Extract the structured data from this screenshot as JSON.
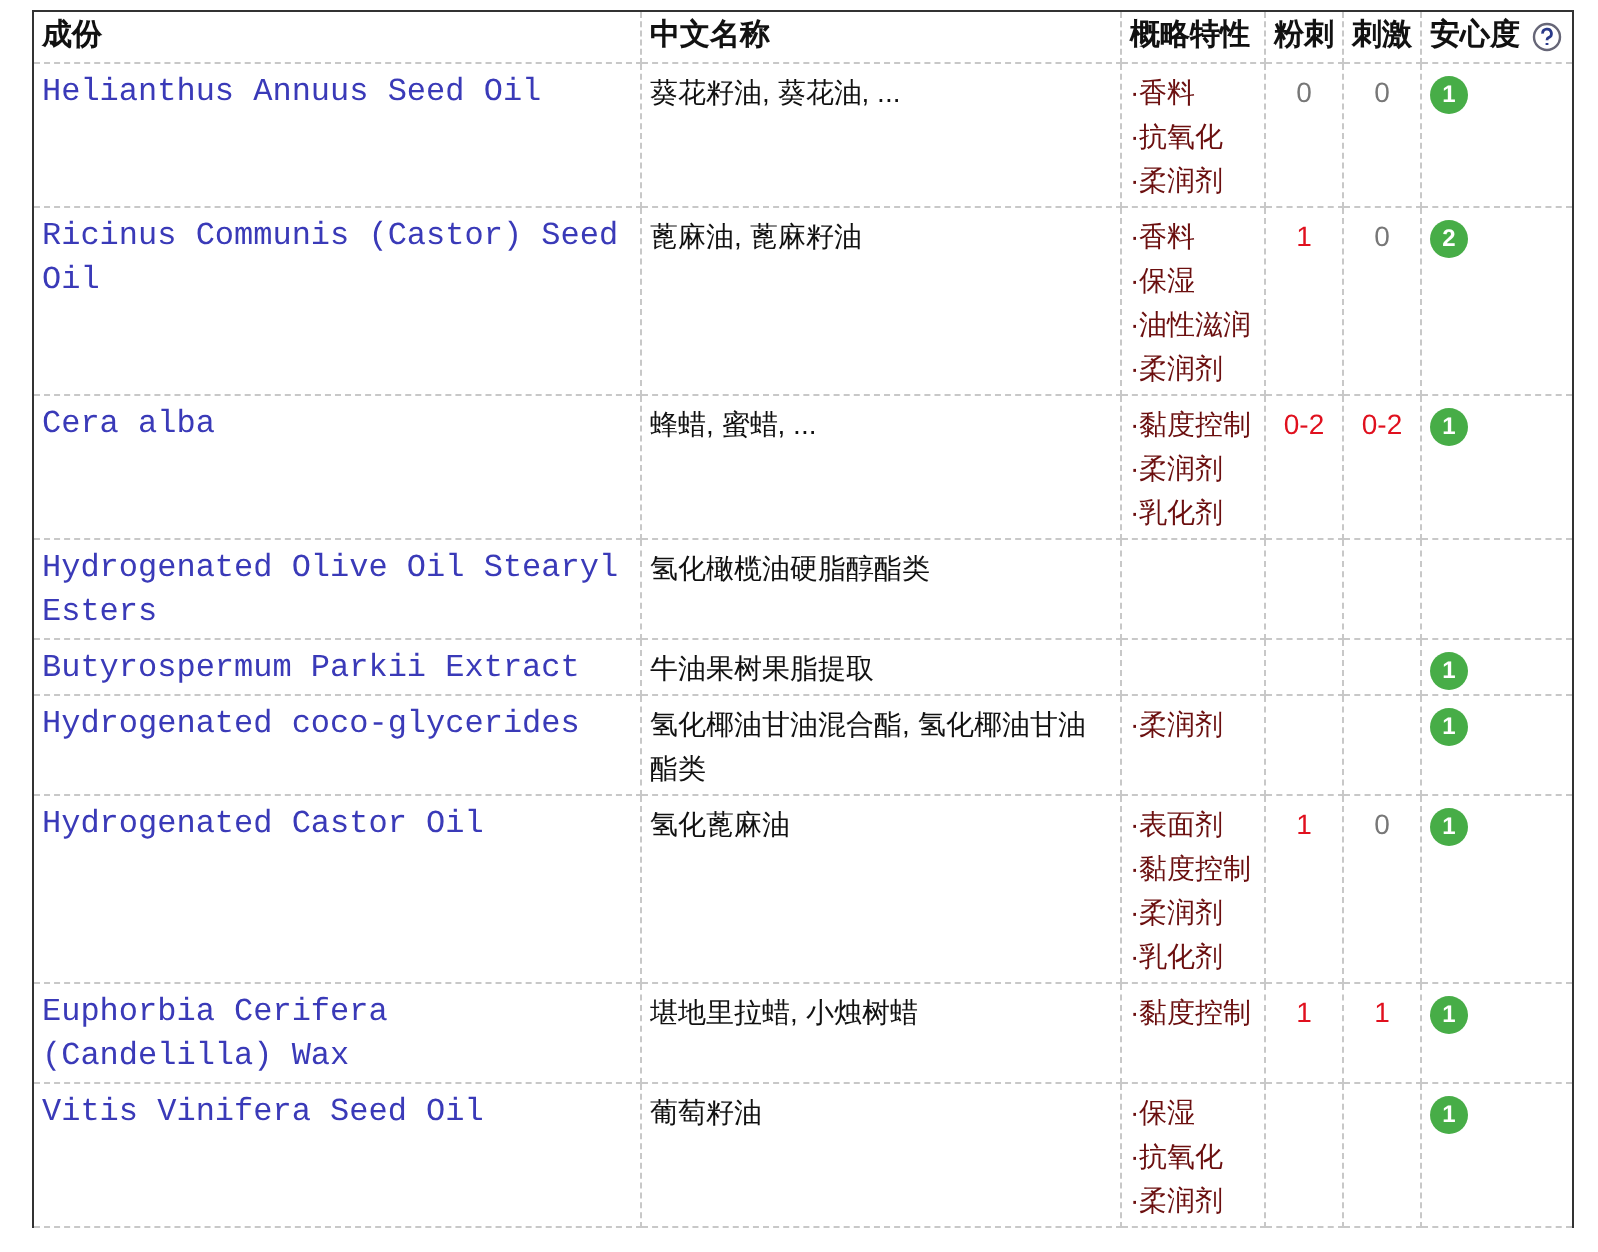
{
  "columns": [
    "成份",
    "中文名称",
    "概略特性",
    "粉刺",
    "刺激",
    "安心度"
  ],
  "rows": [
    {
      "ingredient": "Helianthus Annuus Seed Oil",
      "chinese_name": "葵花籽油, 葵花油, ...",
      "traits": [
        "·香料",
        "·抗氧化",
        "·柔润剂"
      ],
      "acne": {
        "text": "0",
        "color": "#777777"
      },
      "irritation": {
        "text": "0",
        "color": "#777777"
      },
      "safety": "1"
    },
    {
      "ingredient": "Ricinus Communis (Castor) Seed Oil",
      "chinese_name": "蓖麻油, 蓖麻籽油",
      "traits": [
        "·香料",
        "·保湿",
        "·油性滋润",
        "·柔润剂"
      ],
      "acne": {
        "text": "1",
        "color": "#e0101e"
      },
      "irritation": {
        "text": "0",
        "color": "#777777"
      },
      "safety": "2"
    },
    {
      "ingredient": "Cera alba",
      "chinese_name": "蜂蜡, 蜜蜡, ...",
      "traits": [
        "·黏度控制",
        "·柔润剂",
        "·乳化剂"
      ],
      "acne": {
        "text": "0-2",
        "color": "#e0101e"
      },
      "irritation": {
        "text": "0-2",
        "color": "#e0101e"
      },
      "safety": "1"
    },
    {
      "ingredient": "Hydrogenated Olive Oil Stearyl Esters",
      "chinese_name": "氢化橄榄油硬脂醇酯类",
      "traits": []
    },
    {
      "ingredient": "Butyrospermum Parkii Extract",
      "chinese_name": "牛油果树果脂提取",
      "traits": [],
      "safety": "1"
    },
    {
      "ingredient": "Hydrogenated coco-glycerides",
      "chinese_name": "氢化椰油甘油混合酯, 氢化椰油甘油酯类",
      "traits": [
        "·柔润剂"
      ],
      "safety": "1"
    },
    {
      "ingredient": "Hydrogenated Castor Oil",
      "chinese_name": "氢化蓖麻油",
      "traits": [
        "·表面剂",
        "·黏度控制",
        "·柔润剂",
        "·乳化剂"
      ],
      "acne": {
        "text": "1",
        "color": "#e0101e"
      },
      "irritation": {
        "text": "0",
        "color": "#777777"
      },
      "safety": "1"
    },
    {
      "ingredient": "Euphorbia Cerifera (Candelilla) Wax",
      "chinese_name": "堪地里拉蜡, 小烛树蜡",
      "traits": [
        "·黏度控制"
      ],
      "acne": {
        "text": "1",
        "color": "#e0101e"
      },
      "irritation": {
        "text": "1",
        "color": "#e0101e"
      },
      "safety": "1"
    },
    {
      "ingredient": "Vitis Vinifera Seed Oil",
      "chinese_name": "葡萄籽油",
      "traits": [
        "·保湿",
        "·抗氧化",
        "·柔润剂"
      ],
      "safety": "1"
    }
  ]
}
